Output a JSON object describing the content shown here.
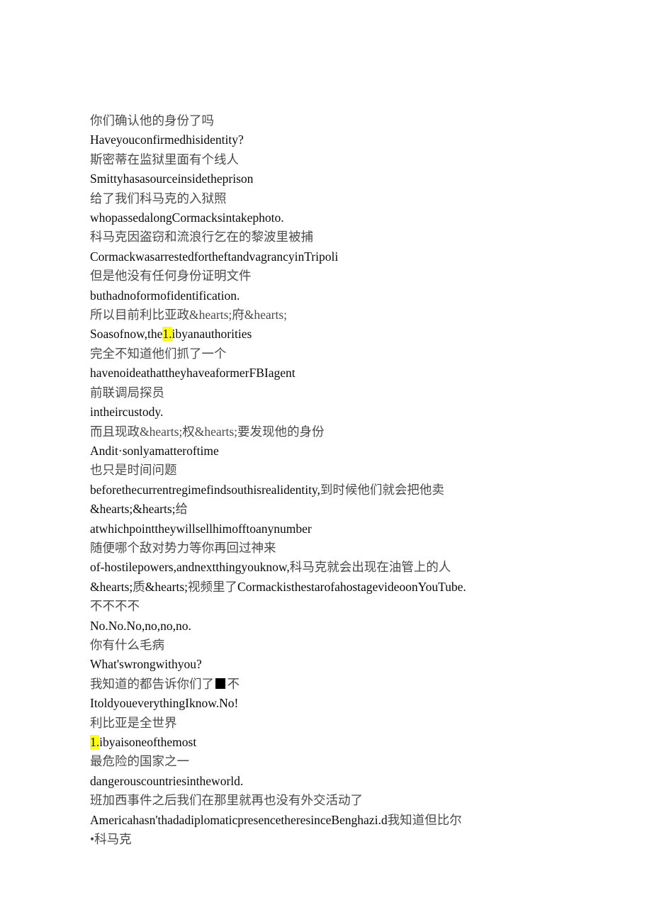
{
  "document": {
    "kind": "bilingual-subtitle-transcript",
    "page_background": "#ffffff",
    "text_color_chinese": "#4a4a4a",
    "text_color_english": "#0a0a0a",
    "highlight_color": "#ffff00",
    "font_style": "serif",
    "lines": [
      {
        "id": "l1",
        "lang": "zh",
        "text": "你们确认他的身份了吗"
      },
      {
        "id": "l2",
        "lang": "en",
        "text": "Haveyouconfirmedhisidentity?"
      },
      {
        "id": "l3",
        "lang": "zh",
        "text": "斯密蒂在监狱里面有个线人"
      },
      {
        "id": "l4",
        "lang": "en",
        "text": "Smittyhasasourceinsidetheprison"
      },
      {
        "id": "l5",
        "lang": "zh",
        "text": "给了我们科马克的入狱照"
      },
      {
        "id": "l6",
        "lang": "en",
        "text": "whopassedalongCormacksintakephoto."
      },
      {
        "id": "l7",
        "lang": "zh",
        "text": "科马克因盗窃和流浪行乞在的黎波里被捕"
      },
      {
        "id": "l8",
        "lang": "en",
        "text": "CormackwasarrestedfortheftandvagrancyinTripoli"
      },
      {
        "id": "l9",
        "lang": "zh",
        "text": "但是他没有任何身份证明文件"
      },
      {
        "id": "l10",
        "lang": "en",
        "text": "buthadnoformofidentification."
      },
      {
        "id": "l11",
        "lang": "zh",
        "text": "所以目前利比亚政&hearts;府&hearts;"
      },
      {
        "id": "l12",
        "lang": "en",
        "segments": [
          {
            "type": "text",
            "text": "Soasofnow,the"
          },
          {
            "type": "highlight",
            "text": "1."
          },
          {
            "type": "text",
            "text": "ibyanauthorities"
          }
        ],
        "plain": "Soasofnow,the1.ibyanauthorities"
      },
      {
        "id": "l13",
        "lang": "zh",
        "text": "完全不知道他们抓了一个"
      },
      {
        "id": "l14",
        "lang": "en",
        "text": "havenoideathattheyhaveaformerFBIagent"
      },
      {
        "id": "l15",
        "lang": "zh",
        "text": "前联调局探员"
      },
      {
        "id": "l16",
        "lang": "en",
        "text": "intheircustody."
      },
      {
        "id": "l17",
        "lang": "zh",
        "text": "而且现政&hearts;权&hearts;要发现他的身份"
      },
      {
        "id": "l18",
        "lang": "en",
        "text": "Andit·sonlyamatteroftime"
      },
      {
        "id": "l19",
        "lang": "zh",
        "text": "也只是时间问题"
      },
      {
        "id": "l20",
        "lang": "mixed",
        "segments": [
          {
            "type": "en",
            "text": "beforethecurrentregimefindsouthisrealidentity,"
          },
          {
            "type": "zh",
            "text": "到时候他们就会把他卖"
          }
        ],
        "plain": "beforethecurrentregimefindsouthisrealidentity,到时候他们就会把他卖"
      },
      {
        "id": "l21",
        "lang": "mixed",
        "segments": [
          {
            "type": "en",
            "text": "&hearts;&hearts;"
          },
          {
            "type": "zh",
            "text": "给"
          }
        ],
        "plain": "&hearts;&hearts;给"
      },
      {
        "id": "l22",
        "lang": "en",
        "text": "atwhichpointtheywillsellhimofftoanynumber"
      },
      {
        "id": "l23",
        "lang": "zh",
        "text": "随便哪个敌对势力等你再回过神来"
      },
      {
        "id": "l24",
        "lang": "mixed",
        "segments": [
          {
            "type": "en",
            "text": "of-hostilepowers,andnextthingyouknow,"
          },
          {
            "type": "zh",
            "text": "科马克就会出现在油管上的人"
          }
        ],
        "plain": "of-hostilepowers,andnextthingyouknow,科马克就会出现在油管上的人"
      },
      {
        "id": "l25",
        "lang": "mixed",
        "segments": [
          {
            "type": "en",
            "text": "&hearts;"
          },
          {
            "type": "zh",
            "text": "质"
          },
          {
            "type": "en",
            "text": "&hearts;"
          },
          {
            "type": "zh",
            "text": "视频里了"
          },
          {
            "type": "en",
            "text": "CormackisthestarofahostagevideoonYouTube."
          }
        ],
        "plain": "&hearts;质&hearts;视频里了CormackisthestarofahostagevideoonYouTube."
      },
      {
        "id": "l26",
        "lang": "zh",
        "text": "不不不不"
      },
      {
        "id": "l27",
        "lang": "en",
        "text": "No.No.No,no,no,no."
      },
      {
        "id": "l28",
        "lang": "zh",
        "text": "你有什么毛病"
      },
      {
        "id": "l29",
        "lang": "en",
        "text": "What'swrongwithyou?"
      },
      {
        "id": "l30",
        "lang": "zh",
        "segments": [
          {
            "type": "text",
            "text": "我知道的都告诉你们了"
          },
          {
            "type": "tofu",
            "text": "■"
          },
          {
            "type": "text",
            "text": "不"
          }
        ],
        "plain": "我知道的都告诉你们了■不"
      },
      {
        "id": "l31",
        "lang": "en",
        "text": "ItoldyoueverythingIknow.No!"
      },
      {
        "id": "l32",
        "lang": "zh",
        "text": "利比亚是全世界"
      },
      {
        "id": "l33",
        "lang": "en",
        "segments": [
          {
            "type": "highlight",
            "text": "1."
          },
          {
            "type": "text",
            "text": "ibyaisoneofthemost"
          }
        ],
        "plain": "1.ibyaisoneofthemost"
      },
      {
        "id": "l34",
        "lang": "zh",
        "text": "最危险的国家之一"
      },
      {
        "id": "l35",
        "lang": "en",
        "text": "dangerouscountriesintheworld."
      },
      {
        "id": "l36",
        "lang": "zh",
        "text": "班加西事件之后我们在那里就再也没有外交活动了"
      },
      {
        "id": "l37",
        "lang": "mixed",
        "segments": [
          {
            "type": "en",
            "text": "Americahasn'thadadiplomaticpresencetheresinceBenghazi.d"
          },
          {
            "type": "zh",
            "text": "我知道但比尔"
          }
        ],
        "plain": "Americahasn'thadadiplomaticpresencetheresinceBenghazi.d我知道但比尔"
      },
      {
        "id": "l38",
        "lang": "zh",
        "text": "•科马克"
      }
    ]
  }
}
